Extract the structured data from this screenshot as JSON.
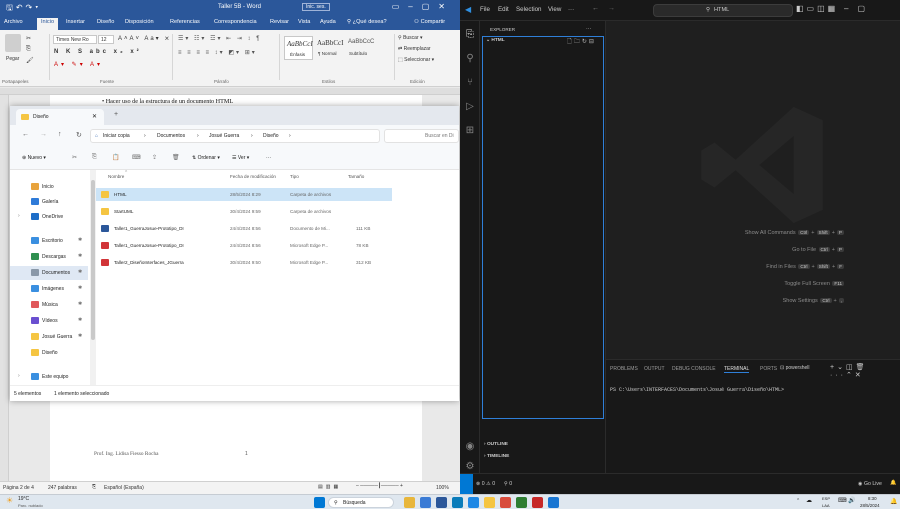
{
  "word": {
    "title": "Taller 5B  -  Word",
    "signin": "Inic. ses.",
    "tabs": [
      "Archivo",
      "Inicio",
      "Insertar",
      "Diseño",
      "Disposición",
      "Referencias",
      "Correspondencia",
      "Revisar",
      "Vista",
      "Ayuda",
      "¿Qué desea?"
    ],
    "share": "Compartir",
    "ribbon": {
      "paste": "Pegar",
      "portapapeles": "Portapapeles",
      "font_name": "Times New Ro",
      "font_size": "12",
      "fuente": "Fuente",
      "parrafo": "Párrafo",
      "styles": [
        {
          "preview": "AaBbCcI",
          "name": "Énfasis"
        },
        {
          "preview": "AaBbCcI",
          "name": "¶ Normal"
        },
        {
          "preview": "AaBbCcC",
          "name": "Subtítulo"
        }
      ],
      "estilos": "Estilos",
      "find": "Buscar",
      "replace": "Reemplazar",
      "select": "Seleccionar",
      "edicion": "Edición"
    },
    "bullet_text": "Hacer uso de la estructura de un documento HTML",
    "footer_text": "Prof. Ing. Lidisa Fiesso Rocha",
    "footer_page": "1",
    "status": {
      "page": "Página 2 de 4",
      "words": "247 palabras",
      "lang": "Español (España)",
      "zoom": "100%"
    }
  },
  "explorer": {
    "tab_title": "Diseño",
    "breadcrumb": [
      "Iniciar copia",
      "Documentos",
      "Josué Guerra",
      "Diseño"
    ],
    "search_placeholder": "Buscar en Di",
    "cmd": {
      "new": "Nuevo",
      "sort": "Ordenar",
      "view": "Ver",
      "more": "···"
    },
    "nav": [
      {
        "label": "Inicio",
        "color": "#e8a33c",
        "pin": false
      },
      {
        "label": "Galería",
        "color": "#2f7bd8",
        "pin": false
      },
      {
        "label": "OneDrive",
        "color": "#1e6ec8",
        "pin": false
      },
      {
        "label": "Escritorio",
        "color": "#3a8fe0",
        "pin": true
      },
      {
        "label": "Descargas",
        "color": "#2f8f4f",
        "pin": true
      },
      {
        "label": "Documentos",
        "color": "#8a98a8",
        "pin": true
      },
      {
        "label": "Imágenes",
        "color": "#3a8fe0",
        "pin": true
      },
      {
        "label": "Música",
        "color": "#e0585b",
        "pin": true
      },
      {
        "label": "Vídeos",
        "color": "#6a4fd0",
        "pin": true
      },
      {
        "label": "Josué Guerra",
        "color": "#f5c542",
        "pin": true
      },
      {
        "label": "Diseño",
        "color": "#f5c542",
        "pin": false
      },
      {
        "label": "Este equipo",
        "color": "#3a8fe0",
        "pin": false
      }
    ],
    "columns": [
      "Nombre",
      "Fecha de modificación",
      "Tipo",
      "Tamaño"
    ],
    "files": [
      {
        "name": "HTML",
        "date": "28/5/2024 8:29",
        "type": "Carpeta de archivos",
        "size": "",
        "icon": "folder-icon",
        "color": "#f5c542"
      },
      {
        "name": "StartUML",
        "date": "30/4/2024 9:59",
        "type": "Carpeta de archivos",
        "size": "",
        "icon": "folder-icon",
        "color": "#f5c542"
      },
      {
        "name": "Taller1_GuerraJosue-Prototipo_DI",
        "date": "24/4/2024 8:56",
        "type": "Documento de Mi...",
        "size": "111 KB",
        "icon": "word-doc-icon",
        "color": "#2b579a"
      },
      {
        "name": "Taller1_GuerraJosue-Prototipo_DI",
        "date": "24/4/2024 8:56",
        "type": "Microsoft Edge P...",
        "size": "78 KB",
        "icon": "pdf-icon",
        "color": "#d13438"
      },
      {
        "name": "Taller2_DiseñoInterfaces_JGuerra",
        "date": "30/4/2024 9:50",
        "type": "Microsoft Edge P...",
        "size": "312 KB",
        "icon": "pdf-icon",
        "color": "#d13438"
      }
    ],
    "status": {
      "count": "5 elementos",
      "selected": "1 elemento seleccionado"
    }
  },
  "vscode": {
    "menu": [
      "File",
      "Edit",
      "Selection",
      "View",
      "···"
    ],
    "search": "HTML",
    "explorer_title": "EXPLORER",
    "explorer_more": "···",
    "folder": "HTML",
    "hints": [
      {
        "label": "Show All Commands",
        "keys": [
          "Ctrl",
          "+",
          "Shift",
          "+",
          "P"
        ]
      },
      {
        "label": "Go to File",
        "keys": [
          "Ctrl",
          "+",
          "P"
        ]
      },
      {
        "label": "Find in Files",
        "keys": [
          "Ctrl",
          "+",
          "Shift",
          "+",
          "F"
        ]
      },
      {
        "label": "Toggle Full Screen",
        "keys": [
          "F11"
        ]
      },
      {
        "label": "Show Settings",
        "keys": [
          "Ctrl",
          "+",
          ","
        ]
      }
    ],
    "panel_tabs": [
      "PROBLEMS",
      "OUTPUT",
      "DEBUG CONSOLE",
      "TERMINAL",
      "PORTS"
    ],
    "terminal_name": "powershell",
    "terminal_line": "PS C:\\Users\\INTERFACES\\Documents\\Josué Guerra\\Diseño\\HTML>",
    "outline": "OUTLINE",
    "timeline": "TIMELINE",
    "status_left": "⊗ 0 ⚠ 0",
    "status_ports": "⚲ 0",
    "go_live": "Go Live"
  },
  "taskbar": {
    "weather_temp": "19°C",
    "weather_desc": "Parc. nublado",
    "search": "Búsqueda",
    "lang": "ESP",
    "lang2": "LAA",
    "time": "8:30",
    "date": "28/5/2024"
  }
}
